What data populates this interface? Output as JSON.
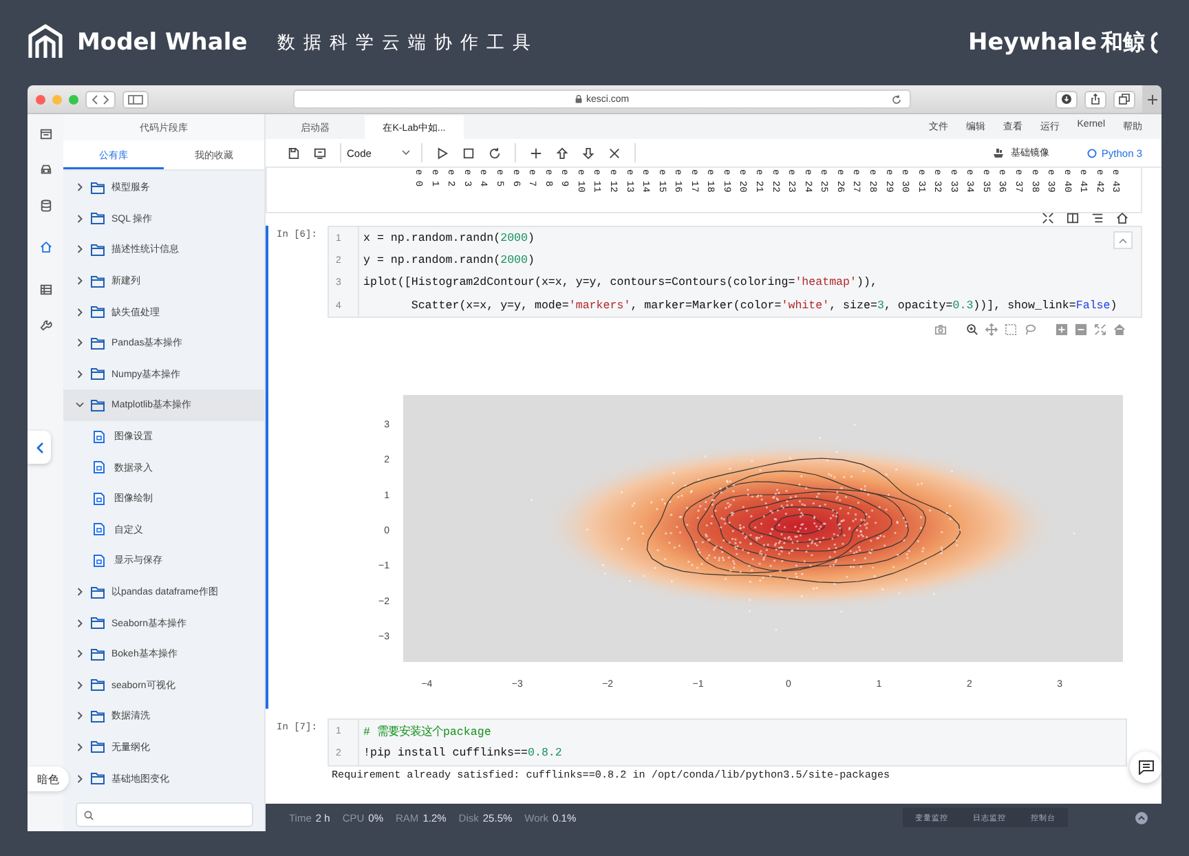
{
  "brand": {
    "name": "Model Whale",
    "tagline": "数据科学云端协作工具",
    "partner": "Heywhale",
    "partner_cn": "和鲸"
  },
  "browser": {
    "url": "kesci.com"
  },
  "sidebar": {
    "title": "代码片段库",
    "tabs": [
      {
        "label": "公有库",
        "selected": true
      },
      {
        "label": "我的收藏",
        "selected": false
      }
    ],
    "items": [
      {
        "label": "模型服务",
        "expanded": false
      },
      {
        "label": "SQL 操作",
        "expanded": false
      },
      {
        "label": "描述性统计信息",
        "expanded": false
      },
      {
        "label": "新建列",
        "expanded": false
      },
      {
        "label": "缺失值处理",
        "expanded": false
      },
      {
        "label": "Pandas基本操作",
        "expanded": false
      },
      {
        "label": "Numpy基本操作",
        "expanded": false
      },
      {
        "label": "Matplotlib基本操作",
        "expanded": true,
        "children": [
          {
            "label": "图像设置"
          },
          {
            "label": "数据录入"
          },
          {
            "label": "图像绘制"
          },
          {
            "label": "自定义"
          },
          {
            "label": "显示与保存"
          }
        ]
      },
      {
        "label": "以pandas dataframe作图",
        "expanded": false
      },
      {
        "label": "Seaborn基本操作",
        "expanded": false
      },
      {
        "label": "Bokeh基本操作",
        "expanded": false
      },
      {
        "label": "seaborn可视化",
        "expanded": false
      },
      {
        "label": "数据清洗",
        "expanded": false
      },
      {
        "label": "无量纲化",
        "expanded": false
      },
      {
        "label": "基础地图变化",
        "expanded": false
      }
    ],
    "theme_button": "暗色"
  },
  "notebook": {
    "tabs": [
      {
        "label": "启动器",
        "selected": false
      },
      {
        "label": "在K-Lab中如...",
        "selected": true
      }
    ],
    "menu": [
      "文件",
      "编辑",
      "查看",
      "运行",
      "Kernel",
      "帮助"
    ],
    "cell_type": "Code",
    "image_button": "基础镜像",
    "kernel": "Python 3",
    "column_headers": [
      "e 0",
      "e 1",
      "e 2",
      "e 3",
      "e 4",
      "e 5",
      "e 6",
      "e 7",
      "e 8",
      "e 9",
      "e 10",
      "e 11",
      "e 12",
      "e 13",
      "e 14",
      "e 15",
      "e 16",
      "e 17",
      "e 18",
      "e 19",
      "e 20",
      "e 21",
      "e 22",
      "e 23",
      "e 24",
      "e 25",
      "e 26",
      "e 27",
      "e 28",
      "e 29",
      "e 30",
      "e 31",
      "e 32",
      "e 33",
      "e 34",
      "e 35",
      "e 36",
      "e 37",
      "e 38",
      "e 39",
      "e 40",
      "e 41",
      "e 42",
      "e 43"
    ],
    "cells": [
      {
        "prompt": "In [6]:",
        "active": true,
        "lines": [
          {
            "no": "1",
            "tokens": [
              {
                "kind": "plain",
                "text": "x = np.random.randn("
              },
              {
                "kind": "number",
                "text": "2000"
              },
              {
                "kind": "plain",
                "text": ")"
              }
            ]
          },
          {
            "no": "2",
            "tokens": [
              {
                "kind": "plain",
                "text": "y = np.random.randn("
              },
              {
                "kind": "number",
                "text": "2000"
              },
              {
                "kind": "plain",
                "text": ")"
              }
            ]
          },
          {
            "no": "3",
            "tokens": [
              {
                "kind": "plain",
                "text": "iplot([Histogram2dContour(x=x, y=y, contours=Contours(coloring="
              },
              {
                "kind": "string",
                "text": "'heatmap'"
              },
              {
                "kind": "plain",
                "text": ")),"
              }
            ]
          },
          {
            "no": "4",
            "tokens": [
              {
                "kind": "plain",
                "text": "       Scatter(x=x, y=y, mode="
              },
              {
                "kind": "string",
                "text": "'markers'"
              },
              {
                "kind": "plain",
                "text": ", marker=Marker(color="
              },
              {
                "kind": "string",
                "text": "'white'"
              },
              {
                "kind": "plain",
                "text": ", size="
              },
              {
                "kind": "number",
                "text": "3"
              },
              {
                "kind": "plain",
                "text": ", opacity="
              },
              {
                "kind": "number",
                "text": "0.3"
              },
              {
                "kind": "plain",
                "text": "))], show_link="
              },
              {
                "kind": "keyword",
                "text": "False"
              },
              {
                "kind": "plain",
                "text": ")"
              }
            ]
          }
        ],
        "plot": {
          "xticks": [
            "−4",
            "−3",
            "−2",
            "−1",
            "0",
            "1",
            "2",
            "3"
          ],
          "yticks": [
            "3",
            "2",
            "1",
            "0",
            "−1",
            "−2",
            "−3"
          ]
        }
      },
      {
        "prompt": "In [7]:",
        "active": false,
        "lines": [
          {
            "no": "1",
            "tokens": [
              {
                "kind": "comment",
                "text": "# 需要安装这个package"
              }
            ]
          },
          {
            "no": "2",
            "tokens": [
              {
                "kind": "plain",
                "text": "!pip install cufflinks=="
              },
              {
                "kind": "number",
                "text": "0.8.2"
              }
            ]
          }
        ],
        "output": "Requirement already satisfied: cufflinks==0.8.2 in /opt/conda/lib/python3.5/site-packages"
      }
    ],
    "status": [
      {
        "label": "Time",
        "value": "2 h"
      },
      {
        "label": "CPU",
        "value": "0%"
      },
      {
        "label": "RAM",
        "value": "1.2%"
      },
      {
        "label": "Disk",
        "value": "25.5%"
      },
      {
        "label": "Work",
        "value": "0.1%"
      }
    ],
    "status_buttons": [
      "变量监控",
      "日志监控",
      "控制台"
    ]
  }
}
